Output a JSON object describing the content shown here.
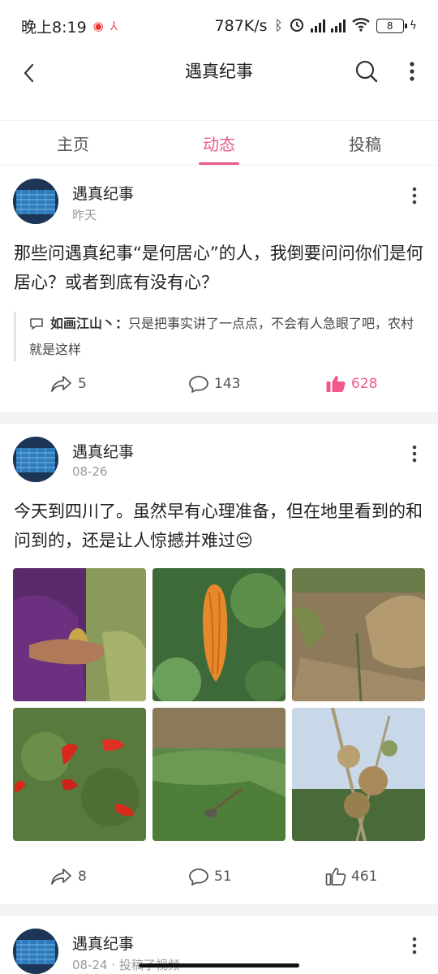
{
  "status_bar": {
    "time": "晚上8:19",
    "speed": "787K/s",
    "battery": "8"
  },
  "header": {
    "title": "遇真纪事"
  },
  "tabs": [
    {
      "label": "主页",
      "active": false
    },
    {
      "label": "动态",
      "active": true
    },
    {
      "label": "投稿",
      "active": false
    }
  ],
  "posts": [
    {
      "author": "遇真纪事",
      "date": "昨天",
      "text": "那些问遇真纪事“是何居心”的人，我倒要问问你们是何居心？或者到底有没有心？",
      "quote": {
        "user": "如画江山丶：",
        "text": "只是把事实讲了一点点，不会有人急眼了吧，农村就是这样"
      },
      "shares": "5",
      "comments": "143",
      "likes": "628",
      "liked": true
    },
    {
      "author": "遇真纪事",
      "date": "08-26",
      "text": "今天到四川了。虽然早有心理准备，但在地里看到的和问到的，还是让人惊撼并难过",
      "emoji": "😔",
      "photos": [
        "photo-hands-corn",
        "photo-bitter-melon",
        "photo-dry-field",
        "photo-red-chilies",
        "photo-grass-hoe",
        "photo-bean-poles"
      ],
      "shares": "8",
      "comments": "51",
      "likes": "461",
      "liked": false
    },
    {
      "author": "遇真纪事",
      "date": "08-24 · 投稿了视频"
    }
  ],
  "colors": {
    "accent": "#e85a8a",
    "divider": "#f3f3f5"
  }
}
